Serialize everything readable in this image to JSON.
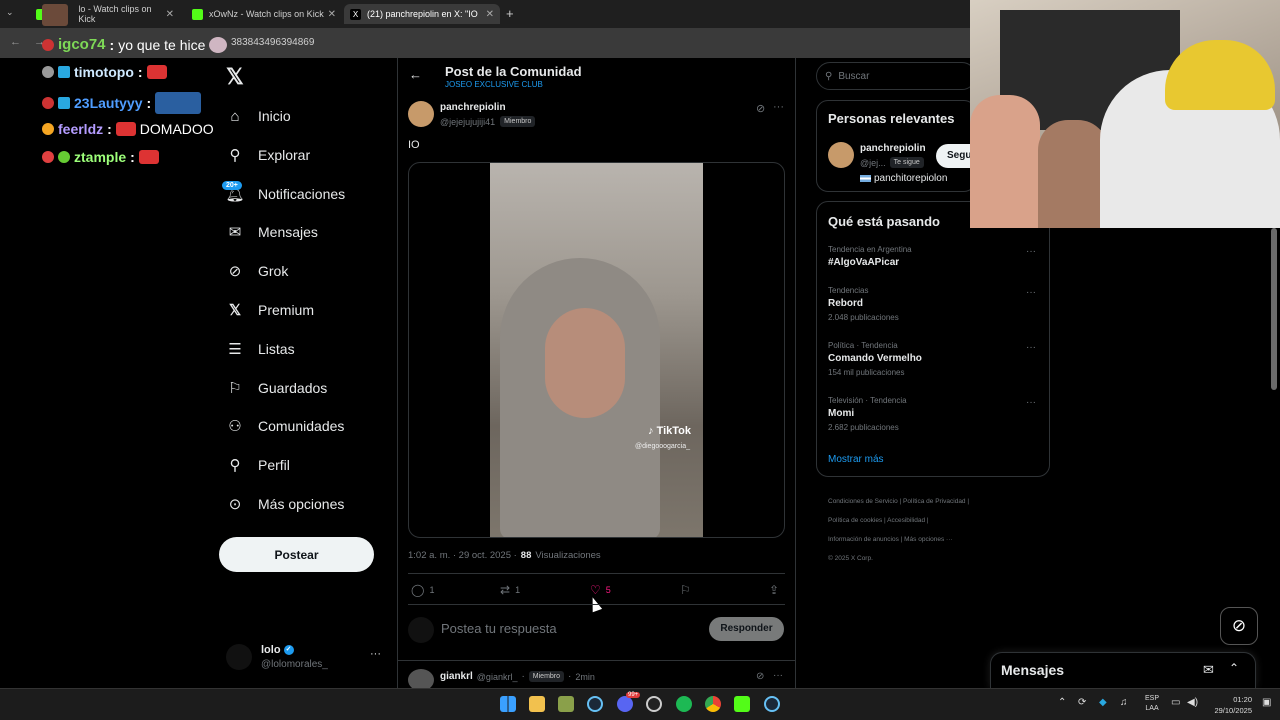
{
  "browser": {
    "tabs": [
      {
        "label": "lo - Watch clips on Kick"
      },
      {
        "label": "xOwNz - Watch clips on Kick"
      },
      {
        "label": "(21) panchrepiolin en X: \"IO"
      }
    ],
    "url_suffix": "383843496394869"
  },
  "chat": [
    {
      "user": "igco74",
      "message": "yo que te hice",
      "color": "#7ed957"
    },
    {
      "user": "timotopo",
      "message": "",
      "color": "#cfe9ff"
    },
    {
      "user": "23Lautyyy",
      "message": "",
      "color": "#4f9dff"
    },
    {
      "user": "feerldz",
      "message": "DOMADOO",
      "color": "#b49cff"
    },
    {
      "user": "ztample",
      "message": "",
      "color": "#9dff7a"
    }
  ],
  "sidebar": {
    "items": [
      {
        "label": "Inicio",
        "icon": "home-icon"
      },
      {
        "label": "Explorar",
        "icon": "search-icon"
      },
      {
        "label": "Notificaciones",
        "icon": "bell-icon",
        "badge": "20+"
      },
      {
        "label": "Mensajes",
        "icon": "mail-icon"
      },
      {
        "label": "Grok",
        "icon": "grok-icon"
      },
      {
        "label": "Premium",
        "icon": "x-logo-icon"
      },
      {
        "label": "Listas",
        "icon": "list-icon"
      },
      {
        "label": "Guardados",
        "icon": "bookmark-icon"
      },
      {
        "label": "Comunidades",
        "icon": "people-icon"
      },
      {
        "label": "Perfil",
        "icon": "person-icon"
      },
      {
        "label": "Más opciones",
        "icon": "more-circle-icon"
      }
    ],
    "post_button": "Postear",
    "account": {
      "name": "lolo",
      "handle": "@lolomorales_"
    }
  },
  "header": {
    "title": "Post de la Comunidad",
    "subtitle": "JOSEO EXCLUSIVE CLUB"
  },
  "post": {
    "author": "panchrepiolin",
    "handle": "@jejejujujiji41",
    "role": "Miembro",
    "text": "IO",
    "watermark": "TikTok",
    "watermark_handle": "@diegooogarcia_",
    "time": "1:02 a. m. · 29 oct. 2025 ·",
    "views_count": "88",
    "views_label": "Visualizaciones",
    "replies": "1",
    "reposts": "1",
    "likes": "5"
  },
  "reply_box": {
    "placeholder": "Postea tu respuesta",
    "button": "Responder"
  },
  "reply": {
    "author": "giankrl",
    "handle": "@giankrl_",
    "role": "Miembro",
    "time": "2min"
  },
  "right": {
    "search_placeholder": "Buscar",
    "relevant_title": "Personas relevantes",
    "relevant_user": {
      "name": "panchrepiolin",
      "handle": "@jej...",
      "follows_you": "Te sigue",
      "follow_button": "Segu",
      "bio": "panchitorepiolon"
    },
    "trends_title": "Qué está pasando",
    "trends": [
      {
        "meta": "Tendencia en Argentina",
        "name": "#AlgoVaAPicar",
        "count": ""
      },
      {
        "meta": "Tendencias",
        "name": "Rebord",
        "count": "2.048 publicaciones"
      },
      {
        "meta": "Política · Tendencia",
        "name": "Comando Vermelho",
        "count": "154 mil publicaciones"
      },
      {
        "meta": "Televisión · Tendencia",
        "name": "Momi",
        "count": "2.682 publicaciones"
      }
    ],
    "show_more": "Mostrar más",
    "footer": [
      "Condiciones de Servicio",
      "Política de Privacidad",
      "Política de cookies",
      "Accesibilidad",
      "Información de anuncios",
      "Más opciones ···",
      "© 2025 X Corp."
    ]
  },
  "messages_label": "Mensajes",
  "taskbar": {
    "lang1": "ESP",
    "lang2": "LAA",
    "time": "01:20",
    "date": "29/10/2025",
    "discord_badge": "99+"
  }
}
